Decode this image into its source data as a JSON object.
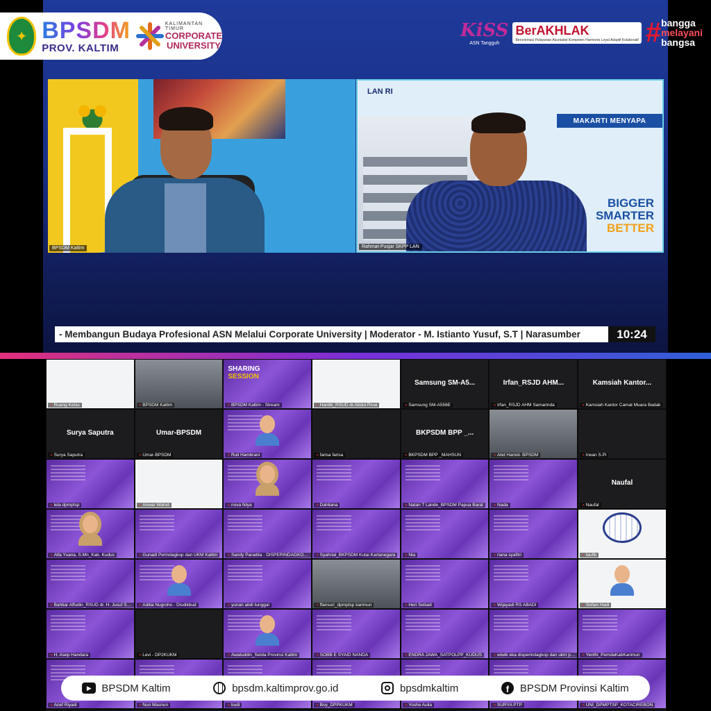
{
  "brand": {
    "name": "BPSDM",
    "region": "PROV. KALTIM",
    "cu_small": "KALIMANTAN TIMUR",
    "cu_line1": "CORPORATE",
    "cu_line2": "UNIVERSITY"
  },
  "right_logos": {
    "kiss": "KiSS",
    "kiss_sub": "ASN Tangguh",
    "berakhlak": "BerAKHLAK",
    "berakhlak_sub": "Berorientasi Pelayanan Akuntabel Kompeten Harmonis Loyal Adaptif Kolaboratif",
    "hash": "#",
    "bangga": [
      "bangga",
      "melayani",
      "bangsa"
    ]
  },
  "videos": {
    "left_label": "BPSDM Kaltim",
    "right_label": "Rahmat-Pusjar SKPP LAN",
    "lan_logo": "LAN RI",
    "makarti": "MAKARTI MENYAPA",
    "slogan": [
      "BIGGER",
      "SMARTER",
      "BETTER"
    ]
  },
  "ticker": {
    "text": "- Membangun Budaya Profesional ASN Melalui Corporate University | Moderator - M. Istianto Yusuf, S.T | Narasumber",
    "time": "10:24"
  },
  "gallery": {
    "tiles": [
      {
        "label": "Ruang Kelas",
        "bg": "t-white"
      },
      {
        "label": "BPSDM Kaltim",
        "bg": "t-cam"
      },
      {
        "label": "BPSDM Kaltim - Stream",
        "bg": "t-purple",
        "sharing": true
      },
      {
        "label": "Hardik_RSUD dr.Abdul Rivai",
        "bg": "t-white"
      },
      {
        "label": "Samsung SM-A556E",
        "bg": "t-dark",
        "big": "Samsung SM-A5..."
      },
      {
        "label": "Irfan_RSJD AHM Samarinda",
        "bg": "t-dark",
        "big": "Irfan_RSJD AHM..."
      },
      {
        "label": "Kamsiah Kantor Camat Muara Badak",
        "bg": "t-dark",
        "big": "Kamsiah Kantor..."
      },
      {
        "label": "Surya Saputra",
        "bg": "t-dark",
        "big": "Surya Saputra"
      },
      {
        "label": "Umar-BPSDM",
        "bg": "t-dark",
        "big": "Umar-BPSDM"
      },
      {
        "label": "Ruli Hambrani",
        "bg": "t-purple",
        "avatar": true
      },
      {
        "label": "farisa farisa",
        "bg": "t-dark"
      },
      {
        "label": "BKPSDM BPP _MAHSUN",
        "bg": "t-dark",
        "big": "BKPSDM BPP _..."
      },
      {
        "label": "Abd Hamid- BPSDM",
        "bg": "t-cam"
      },
      {
        "label": "Irwan S.Pi",
        "bg": "t-dark"
      },
      {
        "label": "lela dpmptsp",
        "bg": "t-purple"
      },
      {
        "label": "Anwar Wahid",
        "bg": "t-white"
      },
      {
        "label": "nova fidya",
        "bg": "t-purple",
        "avatar": "hijab"
      },
      {
        "label": "Dahliana",
        "bg": "t-purple"
      },
      {
        "label": "Natan T Lande_BPSDM Papua Barat",
        "bg": "t-purple"
      },
      {
        "label": "Nada",
        "bg": "t-purple"
      },
      {
        "label": "Naufal",
        "bg": "t-dark",
        "big": "Naufal"
      },
      {
        "label": "Alfa Yuana, S.Mn_Kab. Kudus",
        "bg": "t-purple",
        "avatar": "hijab"
      },
      {
        "label": "Gunadi Perindagkop dan UKM Kaltim",
        "bg": "t-purple"
      },
      {
        "label": "Sandy Paradita - DISPERINDAGKOP KALT...",
        "bg": "t-purple"
      },
      {
        "label": "Syahrial_BKPSDM Kutai Kartanegara",
        "bg": "t-purple"
      },
      {
        "label": "Nia",
        "bg": "t-purple"
      },
      {
        "label": "riana syafitri",
        "bg": "t-purple"
      },
      {
        "label": "taufik",
        "bg": "t-white",
        "globe": true
      },
      {
        "label": "Bahtiar Affudin_RSUD dr. H. Jusuf SK Kal...",
        "bg": "t-purple"
      },
      {
        "label": "Aditia Nugroho - Disdikbud",
        "bg": "t-purple",
        "avatar": true
      },
      {
        "label": "yunan abdi tunggal",
        "bg": "t-purple"
      },
      {
        "label": "ffansuri_dpmptsp karimun",
        "bg": "t-cam"
      },
      {
        "label": "Heri Setiadi",
        "bg": "t-purple"
      },
      {
        "label": "Wijayadi RS ABADI",
        "bg": "t-purple"
      },
      {
        "label": "Sofian Hadi",
        "bg": "t-white",
        "avatar": true
      },
      {
        "label": "H. Asep Handara",
        "bg": "t-purple"
      },
      {
        "label": "Levi - DP2KUKM",
        "bg": "t-dark"
      },
      {
        "label": "Awaluddin_Setda Provinsi Kaltim",
        "bg": "t-purple",
        "avatar": true
      },
      {
        "label": "SOBB E SYAID NANDA",
        "bg": "t-purple"
      },
      {
        "label": "ENDRA JAWA_SATPOLPP_KUDUS",
        "bg": "t-purple"
      },
      {
        "label": "wiwik eka disperindagkop dan ukm prov...",
        "bg": "t-purple"
      },
      {
        "label": "Yenthi_PemdaKabKarimun",
        "bg": "t-purple"
      },
      {
        "label": "Arief Riyadi",
        "bg": "t-purple"
      },
      {
        "label": "Nun Masnun",
        "bg": "t-purple"
      },
      {
        "label": "budi",
        "bg": "t-purple"
      },
      {
        "label": "Boy_DPPKUKM",
        "bg": "t-purple"
      },
      {
        "label": "Yoshe Aulia",
        "bg": "t-purple"
      },
      {
        "label": "SURYA PTP",
        "bg": "t-purple"
      },
      {
        "label": "UNI_DPMPTSP_KOTACIREBON",
        "bg": "t-purple"
      }
    ],
    "sharing_title": "SHARING",
    "sharing_sub": "SESSION"
  },
  "social": {
    "youtube": "BPSDM Kaltim",
    "website": "bpsdm.kaltimprov.go.id",
    "instagram": "bpsdmkaltim",
    "facebook": "BPSDM Provinsi Kaltim"
  }
}
